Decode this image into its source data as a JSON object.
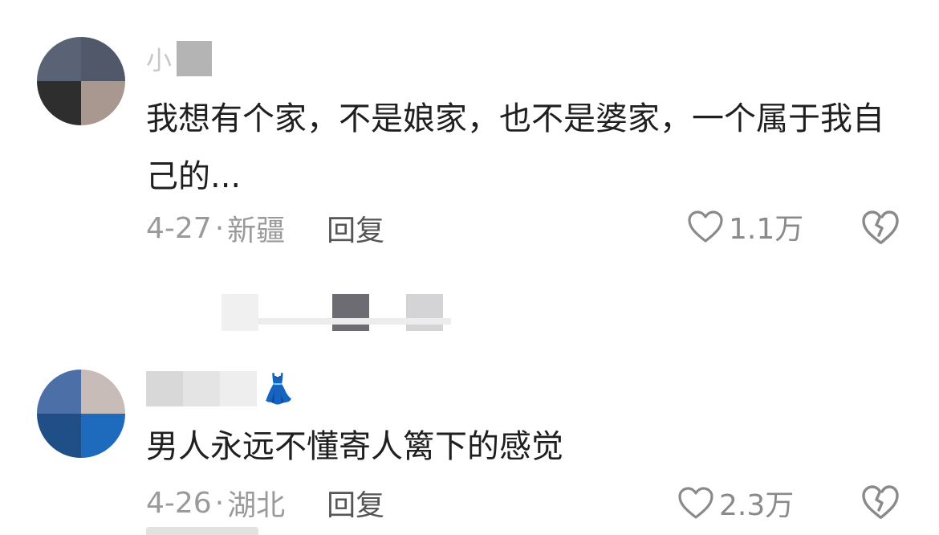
{
  "colors": {
    "text": "#1f1f1f",
    "meta": "#9a9a9a",
    "reply": "#555555",
    "icon": "#8a8a8a"
  },
  "comments": [
    {
      "username_visible": "小",
      "text": "我想有个家，不是娘家，也不是婆家，一个属于我自己的...",
      "date": "4-27",
      "separator": "·",
      "location": "新疆",
      "reply_label": "回复",
      "likes": "1.1万",
      "like_icon": "heart-outline-icon",
      "dislike_icon": "broken-heart-icon"
    },
    {
      "username_visible": "",
      "username_emoji": "👗",
      "text": "男人永远不懂寄人篱下的感觉",
      "date": "4-26",
      "separator": "·",
      "location": "湖北",
      "reply_label": "回复",
      "likes": "2.3万",
      "like_icon": "heart-outline-icon",
      "dislike_icon": "broken-heart-icon"
    }
  ]
}
